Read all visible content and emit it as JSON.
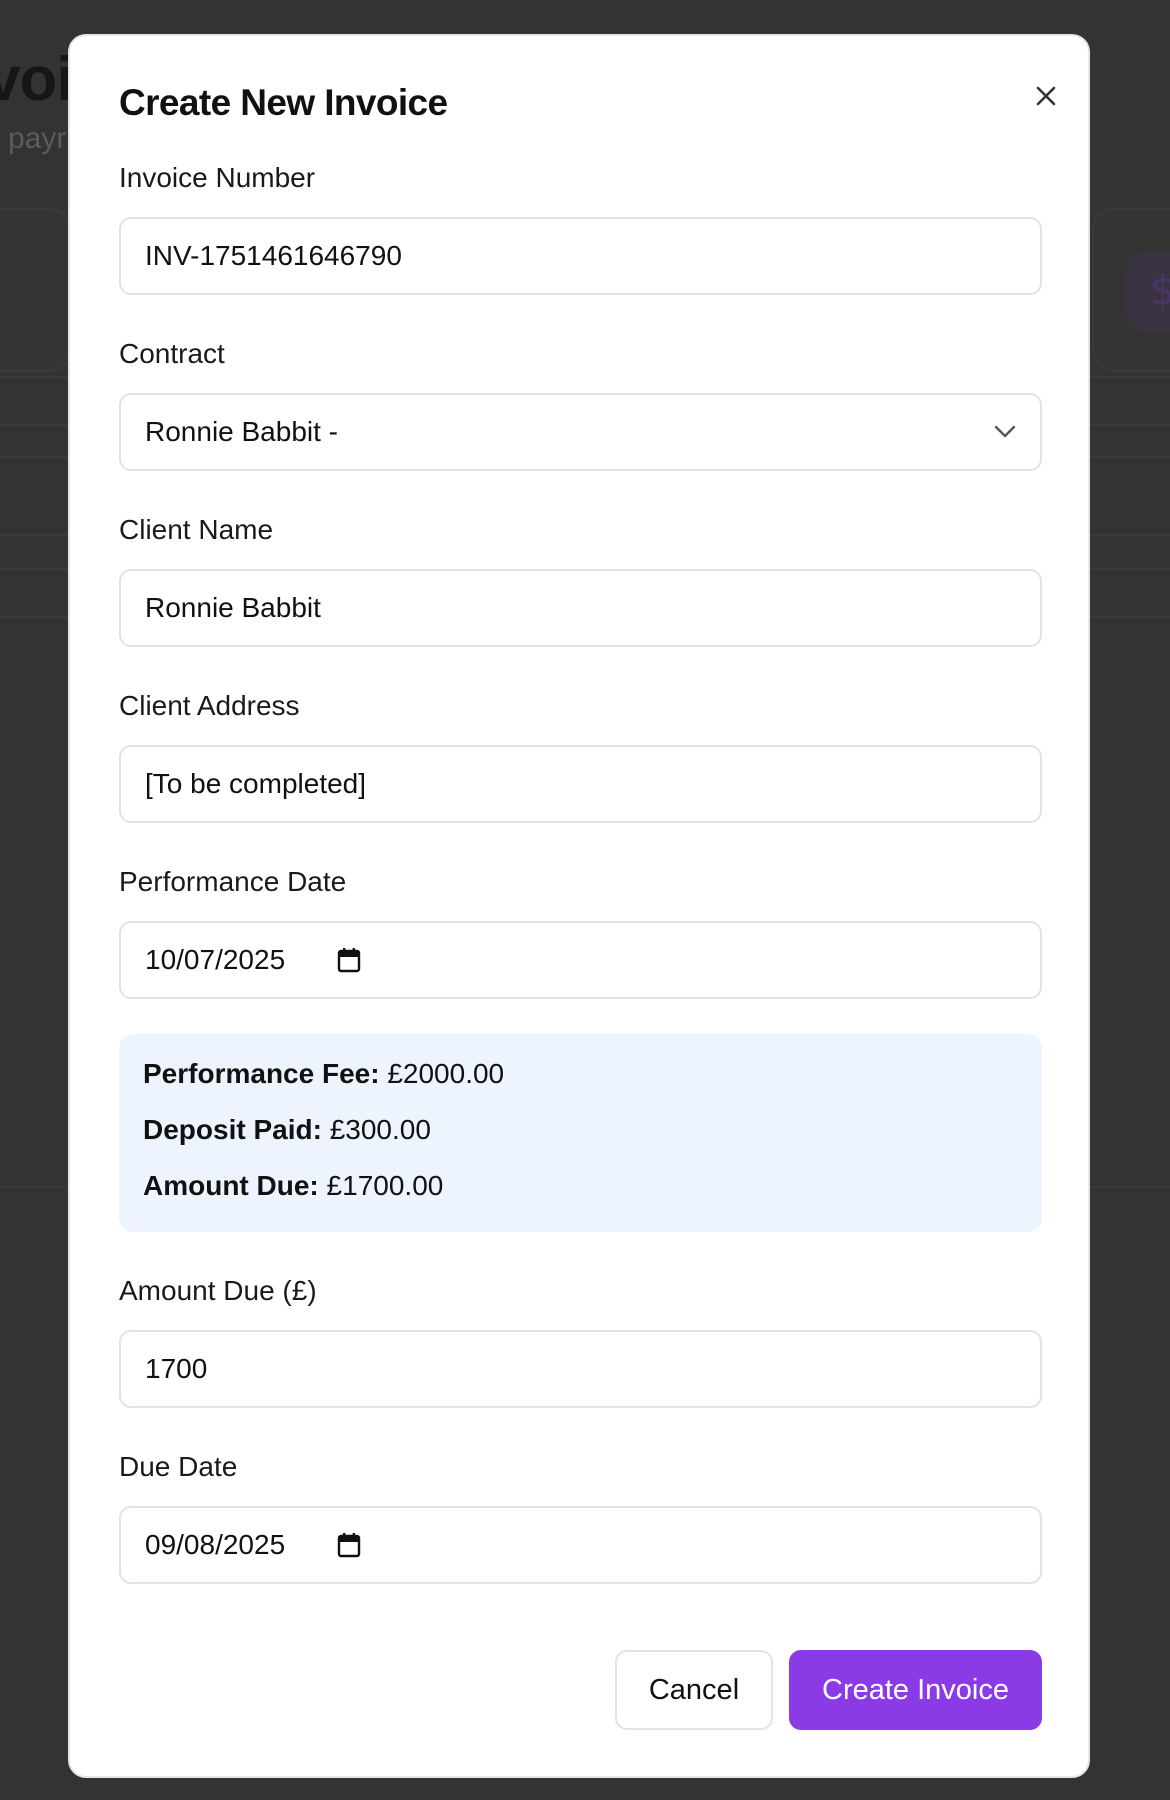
{
  "background": {
    "title_fragment": "voic",
    "subtitle_fragment": "payr",
    "badge_glyph": "$"
  },
  "modal": {
    "title": "Create New Invoice",
    "close_icon": "close-icon",
    "fields": {
      "invoice_number": {
        "label": "Invoice Number",
        "value": "INV-1751461646790"
      },
      "contract": {
        "label": "Contract",
        "value": "Ronnie Babbit -",
        "icon": "chevron-down-icon"
      },
      "client_name": {
        "label": "Client Name",
        "value": "Ronnie Babbit"
      },
      "client_address": {
        "label": "Client Address",
        "value": "[To be completed]"
      },
      "performance_date": {
        "label": "Performance Date",
        "value": "10/07/2025",
        "icon": "calendar-icon"
      },
      "amount_due": {
        "label": "Amount Due (£)",
        "value": "1700"
      },
      "due_date": {
        "label": "Due Date",
        "value": "09/08/2025",
        "icon": "calendar-icon"
      }
    },
    "summary": {
      "performance_fee_label": "Performance Fee:",
      "performance_fee_value": "£2000.00",
      "deposit_paid_label": "Deposit Paid:",
      "deposit_paid_value": "£300.00",
      "amount_due_label": "Amount Due:",
      "amount_due_value": "£1700.00"
    },
    "buttons": {
      "cancel": "Cancel",
      "create": "Create Invoice"
    }
  },
  "colors": {
    "accent": "#8b3be6",
    "summary_bg": "#eef4fd",
    "overlay": "#333333"
  }
}
